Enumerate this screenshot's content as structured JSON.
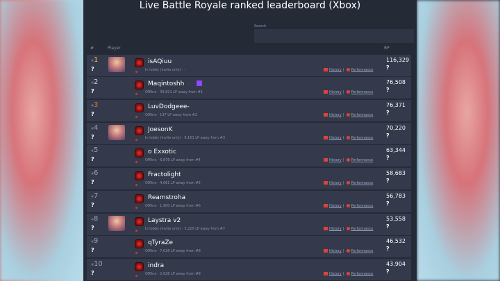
{
  "title": "Live Battle Royale ranked leaderboard (Xbox)",
  "search": {
    "label": "Search",
    "placeholder": ""
  },
  "columns": {
    "rank": "#",
    "player": "Player",
    "rp": "RP"
  },
  "link_history": "History",
  "link_perf": "Performance",
  "rows": [
    {
      "ratio": "#",
      "rank": "1",
      "q": "?",
      "name": "isAQiuu",
      "status": "In lobby (invite only) · -",
      "rp": "116,329",
      "rp_q": "?",
      "tier": "gold",
      "avatar": true,
      "twitch": false
    },
    {
      "ratio": "#",
      "rank": "2",
      "q": "?",
      "name": "Maqintoshh",
      "status": "Offline · 39,821 LP away from #1",
      "rp": "76,508",
      "rp_q": "?",
      "tier": "silver",
      "avatar": false,
      "twitch": true
    },
    {
      "ratio": "#",
      "rank": "3",
      "q": "?",
      "name": "LuvDodgeee-",
      "status": "Offline · 137 LP away from #2",
      "rp": "76,371",
      "rp_q": "?",
      "tier": "bronze",
      "avatar": false,
      "twitch": false
    },
    {
      "ratio": "#",
      "rank": "4",
      "q": "?",
      "name": "JoesonK",
      "status": "In lobby (invite only) · 6,151 LP away from #3",
      "rp": "70,220",
      "rp_q": "?",
      "tier": "",
      "avatar": true,
      "twitch": false
    },
    {
      "ratio": "#",
      "rank": "5",
      "q": "?",
      "name": "o Exxotic",
      "status": "Offline · 6,876 LP away from #4",
      "rp": "63,344",
      "rp_q": "?",
      "tier": "",
      "avatar": false,
      "twitch": false
    },
    {
      "ratio": "#",
      "rank": "6",
      "q": "?",
      "name": "Fractolight",
      "status": "Offline · 4,661 LP away from #5",
      "rp": "58,683",
      "rp_q": "?",
      "tier": "",
      "avatar": false,
      "twitch": false
    },
    {
      "ratio": "#",
      "rank": "7",
      "q": "?",
      "name": "Reamstroha",
      "status": "Offline · 1,900 LP away from #6",
      "rp": "56,783",
      "rp_q": "?",
      "tier": "",
      "avatar": false,
      "twitch": false
    },
    {
      "ratio": "#",
      "rank": "8",
      "q": "?",
      "name": "Laystra v2",
      "status": "In lobby (invite only) · 3,225 LP away from #7",
      "rp": "53,558",
      "rp_q": "?",
      "tier": "",
      "avatar": true,
      "twitch": false
    },
    {
      "ratio": "#",
      "rank": "9",
      "q": "?",
      "name": "qTyraZe",
      "status": "Offline · 7,026 LP away from #8",
      "rp": "46,532",
      "rp_q": "?",
      "tier": "",
      "avatar": false,
      "twitch": false
    },
    {
      "ratio": "#",
      "rank": "10",
      "q": "?",
      "name": "indra",
      "status": "Offline · 2,628 LP away from #9",
      "rp": "43,904",
      "rp_q": "?",
      "tier": "",
      "avatar": false,
      "twitch": false
    }
  ]
}
